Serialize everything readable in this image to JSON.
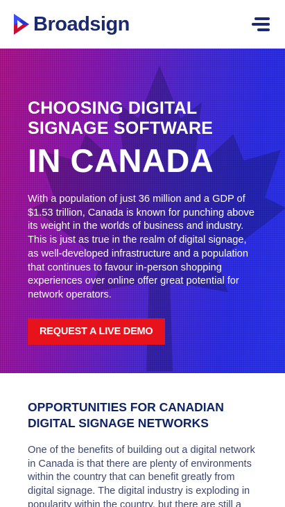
{
  "header": {
    "logo_text": "Broadsign",
    "menu_icon": "hamburger-menu-icon"
  },
  "hero": {
    "title_line1": "CHOOSING DIGITAL SIGNAGE SOFTWARE",
    "title_line2": "IN CANADA",
    "body": "With a population of just 36 million and a GDP of $1.53 trillion, Canada is known for punching above its weight in the worlds of business and industry. This is just as true in the realm of digital signage, as well-developed infrastructure and a population that continues to favour in-person shopping experiences over online offer great potential for network operators.",
    "cta_label": "REQUEST A LIVE DEMO",
    "background_icon": "maple-leaf-icon"
  },
  "section": {
    "title": "OPPORTUNITIES FOR CANADIAN DIGITAL SIGNAGE NETWORKS",
    "body": "One of the benefits of building out a digital network in Canada is that there are plenty of environments within the country that can benefit greatly from digital signage. The digital industry is exploding in popularity within the country, but there are still a great many"
  },
  "colors": {
    "brand_navy": "#1b2a6e",
    "cta_red": "#e8121c",
    "hero_gradient_start": "#b0158c",
    "hero_gradient_end": "#2a35f0"
  }
}
